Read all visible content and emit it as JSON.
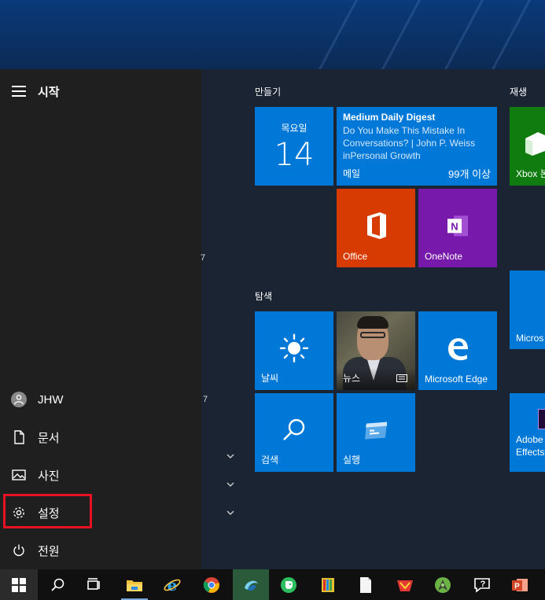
{
  "start_menu": {
    "title": "시작",
    "stray_text_1": "7",
    "stray_text_2": "7",
    "user": {
      "name": "JHW"
    },
    "items": [
      {
        "label": "문서",
        "icon": "document-icon"
      },
      {
        "label": "사진",
        "icon": "pictures-icon"
      },
      {
        "label": "설정",
        "icon": "gear-icon"
      },
      {
        "label": "전원",
        "icon": "power-icon"
      }
    ]
  },
  "groups": {
    "create": "만들기",
    "explore": "탐색",
    "play": "재생"
  },
  "tiles": {
    "calendar": {
      "day_name": "목요일",
      "day_number": "14"
    },
    "mail": {
      "title": "Medium Daily Digest",
      "body": "Do You Make This Mistake In Conversations? | John P. Weiss inPersonal Growth",
      "app": "메일",
      "count": "99개 이상"
    },
    "office": {
      "label": "Office"
    },
    "onenote": {
      "label": "OneNote"
    },
    "weather": {
      "label": "날씨"
    },
    "news": {
      "label": "뉴스"
    },
    "edge": {
      "label": "Microsoft Edge"
    },
    "search": {
      "label": "검색"
    },
    "run": {
      "label": "실행"
    },
    "xbox": {
      "label": "Xbox 본"
    },
    "ms_partial": {
      "label": "Micros"
    },
    "adobe": {
      "label_line1": "Adobe",
      "label_line2": "Effects"
    }
  },
  "taskbar": {
    "apps": [
      "windows-start-icon",
      "search-icon",
      "task-view-icon",
      "file-explorer-icon",
      "internet-explorer-icon",
      "chrome-icon",
      "app-icon",
      "evernote-icon",
      "color-palette-icon",
      "notepad-icon",
      "shop-icon",
      "android-studio-icon",
      "help-icon",
      "powerpoint-icon"
    ]
  },
  "colors": {
    "accent": "#0078d7",
    "office": "#d83b01",
    "onenote": "#7719aa",
    "xbox": "#107c10",
    "highlight": "#e81123"
  }
}
